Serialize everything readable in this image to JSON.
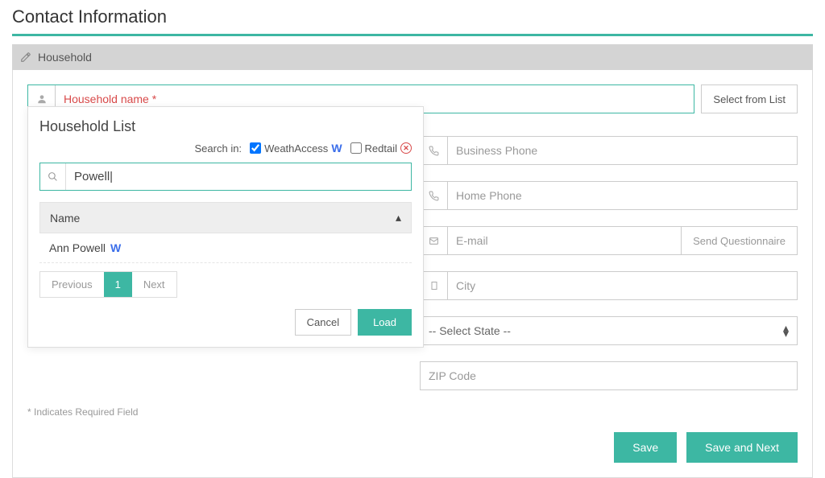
{
  "page": {
    "title": "Contact Information"
  },
  "section": {
    "header": "Household"
  },
  "household_input": {
    "placeholder": "Household name *",
    "select_from_list": "Select from List"
  },
  "right": {
    "business_phone": "Business Phone",
    "home_phone": "Home Phone",
    "email": "E-mail",
    "send_questionnaire": "Send Questionnaire",
    "city": "City",
    "state_placeholder": "-- Select State --",
    "zip": "ZIP Code"
  },
  "footnote": "* Indicates Required Field",
  "actions": {
    "save": "Save",
    "save_next": "Save and Next"
  },
  "popup": {
    "title": "Household List",
    "search_in_label": "Search in:",
    "source1": "WeathAccess",
    "source1_checked": true,
    "source2": "Redtail",
    "source2_checked": false,
    "search_value": "Powell|",
    "column_name": "Name",
    "rows": [
      "Ann Powell"
    ],
    "pager_prev": "Previous",
    "pager_page": "1",
    "pager_next": "Next",
    "cancel": "Cancel",
    "load": "Load"
  }
}
